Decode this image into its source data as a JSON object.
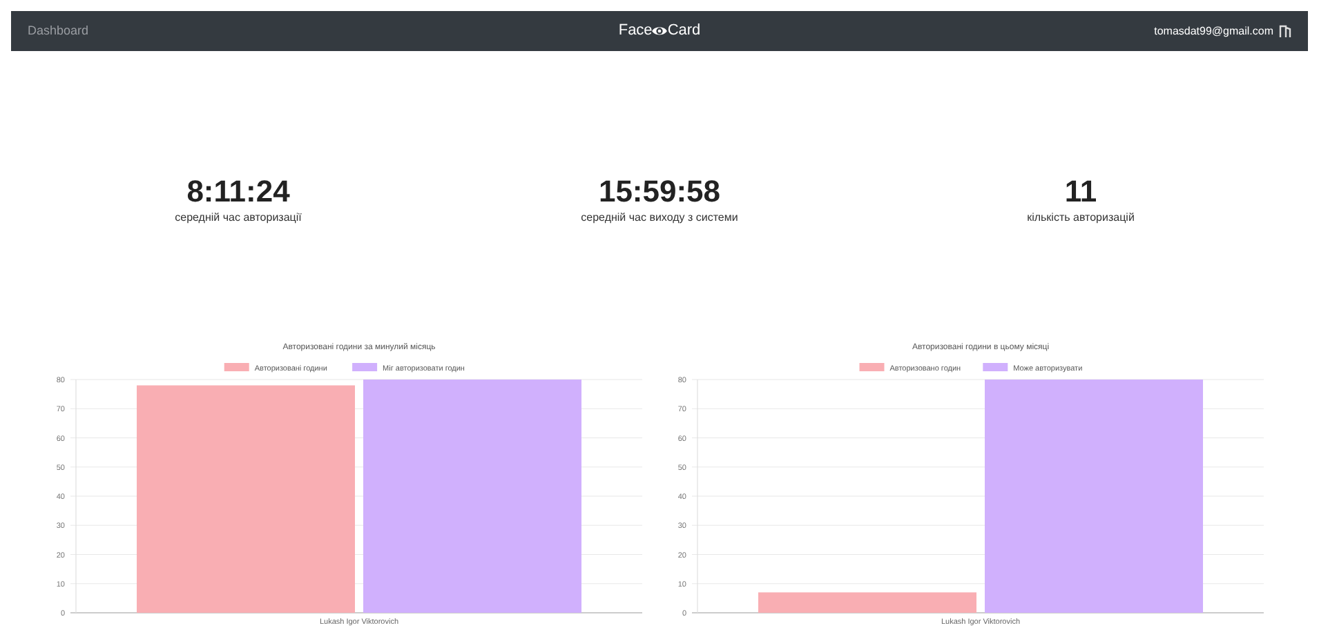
{
  "navbar": {
    "link": "Dashboard",
    "brand": {
      "before": "Face",
      "after": "Card"
    },
    "user_email": "tomasdat99@gmail.com"
  },
  "stats": [
    {
      "value": "8:11:24",
      "label": "середній час авторизації"
    },
    {
      "value": "15:59:58",
      "label": "середній час виходу з системи"
    },
    {
      "value": "11",
      "label": "кількість авторизацій"
    }
  ],
  "charts": [
    {
      "chart_data": {
        "type": "bar",
        "grid": true,
        "legend": "top",
        "title": "Авторизовані години за минулий місяць",
        "categories": [
          "Lukash Igor Viktorovich"
        ],
        "ylim": [
          0,
          80
        ],
        "yticks": [
          0,
          10,
          20,
          30,
          40,
          50,
          60,
          70,
          80
        ],
        "series": [
          {
            "name": "Авторизовані години",
            "color": "#f9aeb3",
            "values": [
              78
            ]
          },
          {
            "name": "Міг авторизовати годин",
            "color": "#d0b0fd",
            "values": [
              80
            ]
          }
        ]
      }
    },
    {
      "chart_data": {
        "type": "bar",
        "grid": true,
        "legend": "top",
        "title": "Авторизовані години в цьому місяці",
        "categories": [
          "Lukash Igor Viktorovich"
        ],
        "ylim": [
          0,
          80
        ],
        "yticks": [
          0,
          10,
          20,
          30,
          40,
          50,
          60,
          70,
          80
        ],
        "series": [
          {
            "name": "Авторизовано годин",
            "color": "#f9aeb3",
            "values": [
              7
            ]
          },
          {
            "name": "Може авторизувати",
            "color": "#d0b0fd",
            "values": [
              80
            ]
          }
        ]
      }
    }
  ]
}
